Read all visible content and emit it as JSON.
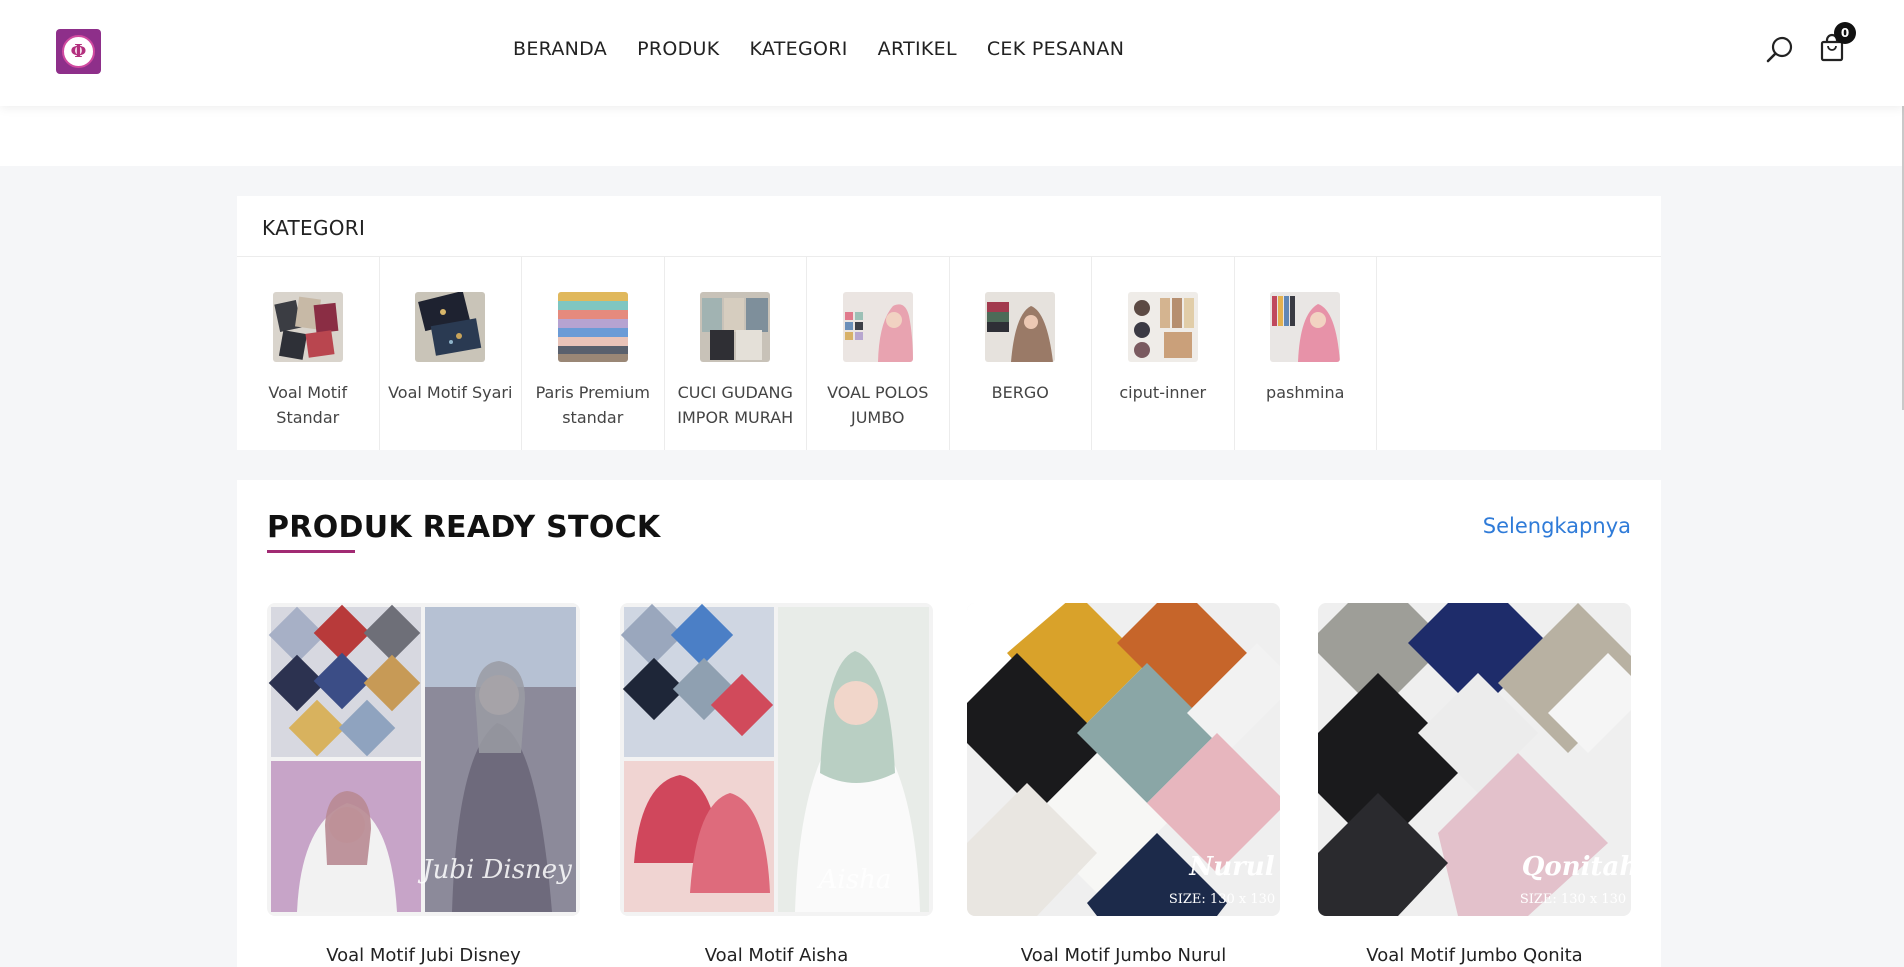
{
  "header": {
    "logo_text": "Φ",
    "nav": [
      "BERANDA",
      "PRODUK",
      "KATEGORI",
      "ARTIKEL",
      "CEK PESANAN"
    ],
    "cart_count": "0"
  },
  "kategori": {
    "title": "KATEGORI",
    "items": [
      {
        "label": "Voal Motif Standar"
      },
      {
        "label": "Voal Motif Syari"
      },
      {
        "label": "Paris Premium standar"
      },
      {
        "label": "CUCI GUDANG IMPOR MURAH"
      },
      {
        "label": "VOAL POLOS JUMBO"
      },
      {
        "label": "BERGO"
      },
      {
        "label": "ciput-inner"
      },
      {
        "label": "pashmina"
      }
    ]
  },
  "produk": {
    "title": "PRODUK READY STOCK",
    "see_more": "Selengkapnya",
    "items": [
      {
        "name": "Voal Motif Jubi Disney",
        "img_text": "Jubi Disney"
      },
      {
        "name": "Voal Motif Aisha",
        "img_text": "Aisha"
      },
      {
        "name": "Voal Motif Jumbo Nurul",
        "img_text": "Nurul",
        "size_text": "SIZE: 130 x 130"
      },
      {
        "name": "Voal Motif Jumbo Qonita",
        "img_text": "Qonitah",
        "size_text": "SIZE: 130 x 130"
      }
    ]
  },
  "colors": {
    "brand": "#8e2f8a",
    "accent_underline": "#a12a73",
    "link": "#2f7bd8"
  }
}
